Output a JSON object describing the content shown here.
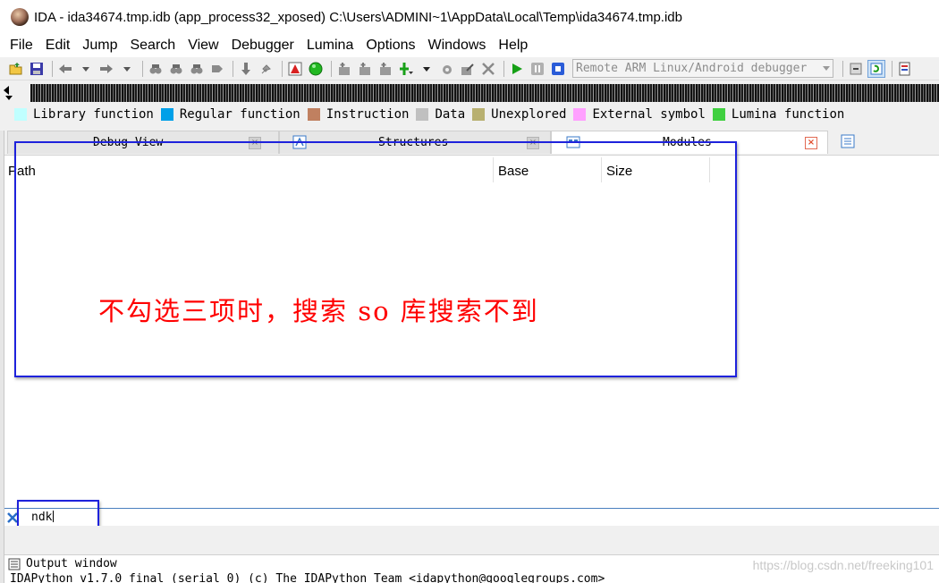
{
  "window": {
    "title": "IDA - ida34674.tmp.idb (app_process32_xposed) C:\\Users\\ADMINI~1\\AppData\\Local\\Temp\\ida34674.tmp.idb"
  },
  "menu": [
    "File",
    "Edit",
    "Jump",
    "Search",
    "View",
    "Debugger",
    "Lumina",
    "Options",
    "Windows",
    "Help"
  ],
  "toolbar": {
    "debugger_select": "Remote ARM Linux/Android debugger"
  },
  "legend": [
    {
      "label": "Library function",
      "color": "#c0ffff"
    },
    {
      "label": "Regular function",
      "color": "#00a0e8"
    },
    {
      "label": "Instruction",
      "color": "#c08060"
    },
    {
      "label": "Data",
      "color": "#c0c0c0"
    },
    {
      "label": "Unexplored",
      "color": "#b8b070"
    },
    {
      "label": "External symbol",
      "color": "#ffa0ff"
    },
    {
      "label": "Lumina function",
      "color": "#40d040"
    }
  ],
  "tabs": [
    {
      "label": "Debug View"
    },
    {
      "label": "Structures"
    },
    {
      "label": "Modules"
    }
  ],
  "table": {
    "columns": [
      "Path",
      "Base",
      "Size"
    ]
  },
  "annotation": "不勾选三项时，搜索 so 库搜索不到",
  "filter": {
    "value": "ndk"
  },
  "output": {
    "title": "Output window",
    "line": "IDAPython v1.7.0 final (serial 0) (c) The IDAPython Team <idapython@googlegroups.com>"
  },
  "watermark": "https://blog.csdn.net/freeking101",
  "colors": {
    "accent_blue": "#1e22dc",
    "annotation_red": "#ff0000"
  }
}
